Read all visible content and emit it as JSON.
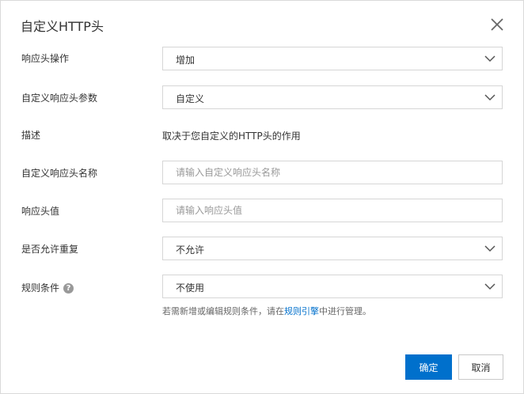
{
  "dialog": {
    "title": "自定义HTTP头",
    "close_icon": "close-icon"
  },
  "form": {
    "action": {
      "label": "响应头操作",
      "value": "增加"
    },
    "param": {
      "label": "自定义响应头参数",
      "value": "自定义"
    },
    "description": {
      "label": "描述",
      "text": "取决于您自定义的HTTP头的作用"
    },
    "header_name": {
      "label": "自定义响应头名称",
      "value": "",
      "placeholder": "请输入自定义响应头名称"
    },
    "header_value": {
      "label": "响应头值",
      "value": "",
      "placeholder": "请输入响应头值"
    },
    "allow_duplicate": {
      "label": "是否允许重复",
      "value": "不允许"
    },
    "rule_condition": {
      "label": "规则条件",
      "help_icon": "question-circle-icon",
      "value": "不使用",
      "hint_prefix": "若需新增或编辑规则条件，请在",
      "hint_link": "规则引擎",
      "hint_suffix": "中进行管理。"
    }
  },
  "buttons": {
    "ok_label": "确定",
    "cancel_label": "取消"
  },
  "colors": {
    "primary": "#0070cc",
    "border": "#d6d6d6",
    "text": "#333333",
    "placeholder": "#999999"
  }
}
